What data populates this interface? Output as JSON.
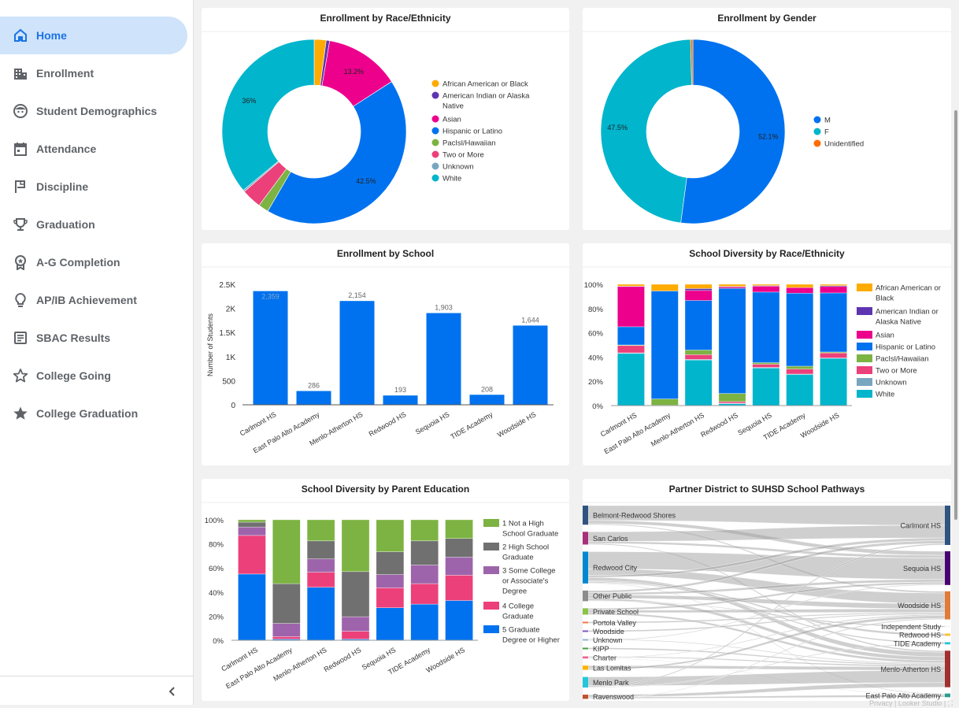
{
  "sidebar": {
    "items": [
      {
        "label": "Home",
        "icon": "home-icon",
        "active": true
      },
      {
        "label": "Enrollment",
        "icon": "building-icon"
      },
      {
        "label": "Student Demographics",
        "icon": "face-icon"
      },
      {
        "label": "Attendance",
        "icon": "calendar-icon"
      },
      {
        "label": "Discipline",
        "icon": "flag-icon"
      },
      {
        "label": "Graduation",
        "icon": "trophy-icon"
      },
      {
        "label": "A-G Completion",
        "icon": "award-icon"
      },
      {
        "label": "AP/IB Achievement",
        "icon": "lightbulb-icon"
      },
      {
        "label": "SBAC Results",
        "icon": "document-icon"
      },
      {
        "label": "College Going",
        "icon": "star-outline-icon"
      },
      {
        "label": "College Graduation",
        "icon": "star-filled-icon"
      }
    ],
    "collapse_icon": "chevron-left-icon"
  },
  "colors": {
    "accent": "#1a73e8",
    "active_bg": "#cfe3fa",
    "race": {
      "African American or Black": "#ffab00",
      "American Indian or Alaska Native": "#5e35b1",
      "Asian": "#ec008c",
      "Hispanic or Latino": "#0072ef",
      "PacIsl/Hawaiian": "#7cb342",
      "Two or More": "#ec407a",
      "Unknown": "#78a6c0",
      "White": "#00b5cc"
    },
    "gender": {
      "M": "#0072ef",
      "F": "#00b5cc",
      "Unidentified": "#ff6d00"
    },
    "parent_ed": [
      "#7cb342",
      "#707070",
      "#9e64ab",
      "#ec407a",
      "#0072ef"
    ]
  },
  "chart_data": [
    {
      "id": "race",
      "type": "pie",
      "title": "Enrollment by Race/Ethnicity",
      "legend_position": "right",
      "slices": [
        {
          "label": "African American or Black",
          "value": 2.1
        },
        {
          "label": "American Indian or Alaska Native",
          "value": 0.6
        },
        {
          "label": "Asian",
          "value": 13.2,
          "data_label": "13.2%"
        },
        {
          "label": "Hispanic or Latino",
          "value": 42.5,
          "data_label": "42.5%"
        },
        {
          "label": "PacIsl/Hawaiian",
          "value": 1.8
        },
        {
          "label": "Two or More",
          "value": 3.5
        },
        {
          "label": "Unknown",
          "value": 0.3
        },
        {
          "label": "White",
          "value": 36.0,
          "data_label": "36%"
        }
      ],
      "legend": [
        "African American or Black",
        "American Indian or Alaska Native",
        "Asian",
        "Hispanic or Latino",
        "PacIsl/Hawaiian",
        "Two or More",
        "Unknown",
        "White"
      ]
    },
    {
      "id": "gender",
      "type": "pie",
      "title": "Enrollment by Gender",
      "legend_position": "right",
      "slices": [
        {
          "label": "M",
          "value": 52.1,
          "data_label": "52.1%"
        },
        {
          "label": "F",
          "value": 47.5,
          "data_label": "47.5%"
        },
        {
          "label": "Unidentified",
          "value": 0.4
        }
      ],
      "legend": [
        "M",
        "F",
        "Unidentified"
      ]
    },
    {
      "id": "school",
      "type": "bar",
      "title": "Enrollment by School",
      "xlabel": "",
      "ylabel": "Number of Students",
      "ylim": [
        0,
        2500
      ],
      "yticks": [
        {
          "v": 0,
          "label": "0"
        },
        {
          "v": 500,
          "label": "500"
        },
        {
          "v": 1000,
          "label": "1K"
        },
        {
          "v": 1500,
          "label": "1.5K"
        },
        {
          "v": 2000,
          "label": "2K"
        },
        {
          "v": 2500,
          "label": "2.5K"
        }
      ],
      "categories": [
        "Carlmont HS",
        "East Palo Alto Academy",
        "Menlo-Atherton HS",
        "Redwood HS",
        "Sequoia HS",
        "TIDE Academy",
        "Woodside HS"
      ],
      "values": [
        2359,
        286,
        2154,
        193,
        1903,
        208,
        1644
      ],
      "data_labels": [
        "2,359",
        "286",
        "2,154",
        "193",
        "1,903",
        "208",
        "1,644"
      ]
    },
    {
      "id": "diversity",
      "type": "bar",
      "stacked": "percent",
      "title": "School Diversity by Race/Ethnicity",
      "legend_position": "right",
      "ylim": [
        0,
        100
      ],
      "yticks": [
        "0%",
        "20%",
        "40%",
        "60%",
        "80%",
        "100%"
      ],
      "categories": [
        "Carlmont HS",
        "East Palo Alto Academy",
        "Menlo-Atherton HS",
        "Redwood HS",
        "Sequoia HS",
        "TIDE Academy",
        "Woodside HS"
      ],
      "series": [
        {
          "name": "White",
          "values": [
            43.0,
            0.0,
            37.6,
            1.5,
            31.0,
            25.7,
            39.0
          ]
        },
        {
          "name": "Unknown",
          "values": [
            0.5,
            0.0,
            0.5,
            0.5,
            0.5,
            0.3,
            0.3
          ]
        },
        {
          "name": "Two or More",
          "values": [
            6.0,
            0.3,
            3.9,
            1.3,
            2.6,
            4.1,
            4.1
          ]
        },
        {
          "name": "PacIsl/Hawaiian",
          "values": [
            0.5,
            5.2,
            3.8,
            6.7,
            1.3,
            2.4,
            0.8
          ]
        },
        {
          "name": "Hispanic or Latino",
          "values": [
            15.0,
            89.0,
            40.9,
            86.7,
            58.2,
            60.2,
            48.7
          ]
        },
        {
          "name": "Asian",
          "values": [
            33.2,
            0.0,
            8.2,
            1.1,
            4.9,
            4.6,
            5.3
          ]
        },
        {
          "name": "American Indian or Alaska Native",
          "values": [
            0.3,
            0.0,
            1.6,
            0.5,
            0.5,
            0.0,
            0.7
          ]
        },
        {
          "name": "African American or Black",
          "values": [
            1.5,
            5.5,
            3.5,
            1.7,
            1.0,
            2.7,
            1.1
          ]
        }
      ],
      "legend": [
        "African American or Black",
        "American Indian or Alaska Native",
        "Asian",
        "Hispanic or Latino",
        "PacIsl/Hawaiian",
        "Two or More",
        "Unknown",
        "White"
      ]
    },
    {
      "id": "parent_ed",
      "type": "bar",
      "stacked": "percent",
      "title": "School Diversity by Parent Education",
      "legend_position": "right",
      "ylim": [
        0,
        100
      ],
      "yticks": [
        "0%",
        "20%",
        "40%",
        "60%",
        "80%",
        "100%"
      ],
      "categories": [
        "Carlmont HS",
        "East Palo Alto Academy",
        "Menlo-Atherton HS",
        "Redwood HS",
        "Sequoia HS",
        "TIDE Academy",
        "Woodside HS"
      ],
      "series": [
        {
          "name": "5 Graduate Degree or Higher",
          "values": [
            55.0,
            1.0,
            44.0,
            1.0,
            27.0,
            30.0,
            33.0
          ]
        },
        {
          "name": "4 College Graduate",
          "values": [
            32.0,
            2.0,
            12.5,
            6.5,
            16.5,
            17.0,
            21.0
          ]
        },
        {
          "name": "3 Some College or Associate's Degree",
          "values": [
            7.0,
            11.0,
            11.0,
            12.0,
            11.0,
            15.5,
            15.0
          ]
        },
        {
          "name": "2 High School Graduate",
          "values": [
            4.0,
            33.0,
            15.0,
            37.5,
            19.0,
            20.0,
            15.5
          ]
        },
        {
          "name": "1 Not a High School Graduate",
          "values": [
            2.0,
            53.0,
            17.5,
            43.0,
            26.5,
            17.5,
            15.5
          ]
        }
      ],
      "legend": [
        "1 Not a High School Graduate",
        "2 High School Graduate",
        "3 Some College or Associate's Degree",
        "4 College Graduate",
        "5 Graduate Degree or Higher"
      ]
    },
    {
      "id": "pathways",
      "type": "sankey",
      "title": "Partner District to SUHSD School Pathways",
      "sources": [
        {
          "name": "Belmont-Redwood Shores",
          "color": "#2f5480",
          "weight": 9
        },
        {
          "name": "San Carlos",
          "color": "#a8307a",
          "weight": 6
        },
        {
          "name": "Redwood City",
          "color": "#0288d1",
          "weight": 15
        },
        {
          "name": "Other Public",
          "color": "#8d8d8d",
          "weight": 5
        },
        {
          "name": "Private School",
          "color": "#8bc34a",
          "weight": 3
        },
        {
          "name": "Portola Valley",
          "color": "#ff7043",
          "weight": 0.4
        },
        {
          "name": "Woodside",
          "color": "#7e57c2",
          "weight": 0.3
        },
        {
          "name": "Unknown",
          "color": "#90b4ce",
          "weight": 0.6
        },
        {
          "name": "KIPP",
          "color": "#43a047",
          "weight": 0.4
        },
        {
          "name": "Charter",
          "color": "#f06292",
          "weight": 1
        },
        {
          "name": "Las Lomitas",
          "color": "#ffb300",
          "weight": 2
        },
        {
          "name": "Menlo Park",
          "color": "#26c6da",
          "weight": 5
        },
        {
          "name": "Ravenswood",
          "color": "#c0522d",
          "weight": 2
        }
      ],
      "targets": [
        {
          "name": "Carlmont HS",
          "color": "#2f5480",
          "weight": 14
        },
        {
          "name": "Sequoia HS",
          "color": "#4a0072",
          "weight": 12
        },
        {
          "name": "Woodside HS",
          "color": "#e07b39",
          "weight": 10
        },
        {
          "name": "Independent Study",
          "color": "#f5f5f5",
          "weight": 0.2
        },
        {
          "name": "Redwood HS",
          "color": "#fbc02d",
          "weight": 0.8
        },
        {
          "name": "TIDE Academy",
          "color": "#26c6da",
          "weight": 0.8
        },
        {
          "name": "Menlo-Atherton HS",
          "color": "#a0302f",
          "weight": 13
        },
        {
          "name": "East Palo Alto Academy",
          "color": "#2a9d8f",
          "weight": 1.3
        }
      ],
      "links": [
        [
          0,
          0,
          7
        ],
        [
          0,
          1,
          1.5
        ],
        [
          0,
          2,
          0.5
        ],
        [
          1,
          0,
          4.5
        ],
        [
          1,
          1,
          1
        ],
        [
          1,
          6,
          0.5
        ],
        [
          2,
          1,
          8
        ],
        [
          2,
          2,
          3
        ],
        [
          2,
          0,
          1
        ],
        [
          2,
          6,
          1.5
        ],
        [
          2,
          4,
          0.5
        ],
        [
          2,
          5,
          0.5
        ],
        [
          2,
          7,
          0.3
        ],
        [
          3,
          0,
          1
        ],
        [
          3,
          1,
          1
        ],
        [
          3,
          2,
          1.5
        ],
        [
          3,
          6,
          1.2
        ],
        [
          3,
          3,
          0.2
        ],
        [
          4,
          1,
          0.8
        ],
        [
          4,
          2,
          1
        ],
        [
          4,
          6,
          0.8
        ],
        [
          5,
          2,
          0.3
        ],
        [
          6,
          2,
          0.3
        ],
        [
          7,
          6,
          0.3
        ],
        [
          7,
          1,
          0.3
        ],
        [
          8,
          6,
          0.4
        ],
        [
          9,
          6,
          0.5
        ],
        [
          9,
          2,
          0.3
        ],
        [
          9,
          7,
          0.2
        ],
        [
          10,
          6,
          1.2
        ],
        [
          10,
          2,
          0.8
        ],
        [
          11,
          6,
          4
        ],
        [
          11,
          0,
          0.5
        ],
        [
          11,
          5,
          0.3
        ],
        [
          12,
          6,
          1.5
        ],
        [
          12,
          7,
          0.8
        ],
        [
          12,
          2,
          0.3
        ]
      ]
    }
  ],
  "footer": {
    "links": "Privacy | Looker Studio | ⛶"
  }
}
